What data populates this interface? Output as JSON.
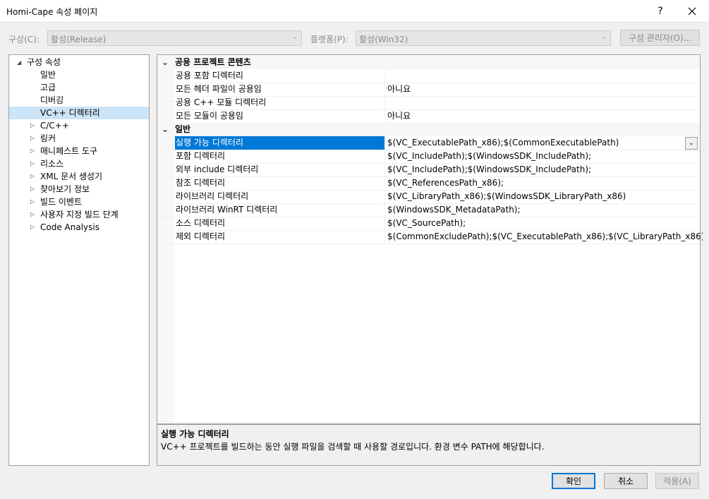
{
  "window": {
    "title": "Homi-Cape 속성 페이지",
    "help_label": "?",
    "close_label": "✕"
  },
  "toolbar": {
    "config_label": "구성(C):",
    "config_value": "활성(Release)",
    "platform_label": "플랫폼(P):",
    "platform_value": "활성(Win32)",
    "config_manager_label": "구성 관리자(O)..."
  },
  "tree": {
    "root": "구성 속성",
    "items": [
      {
        "label": "일반"
      },
      {
        "label": "고급"
      },
      {
        "label": "디버깅"
      },
      {
        "label": "VC++ 디렉터리"
      },
      {
        "label": "C/C++"
      },
      {
        "label": "링커"
      },
      {
        "label": "매니페스트 도구"
      },
      {
        "label": "리소스"
      },
      {
        "label": "XML 문서 생성기"
      },
      {
        "label": "찾아보기 정보"
      },
      {
        "label": "빌드 이벤트"
      },
      {
        "label": "사용자 지정 빌드 단계"
      },
      {
        "label": "Code Analysis"
      }
    ]
  },
  "grid": {
    "categories": [
      {
        "name": "공용 프로젝트 콘텐츠",
        "rows": [
          {
            "name": "공용 포함 디렉터리",
            "value": ""
          },
          {
            "name": "모든 헤더 파일이 공용임",
            "value": "아니요"
          },
          {
            "name": "공용 C++ 모듈 디렉터리",
            "value": ""
          },
          {
            "name": "모든 모듈이 공용임",
            "value": "아니요"
          }
        ]
      },
      {
        "name": "일반",
        "rows": [
          {
            "name": "실행 가능 디렉터리",
            "value": "$(VC_ExecutablePath_x86);$(CommonExecutablePath)"
          },
          {
            "name": "포함 디렉터리",
            "value": "$(VC_IncludePath);$(WindowsSDK_IncludePath);"
          },
          {
            "name": "외부 include 디렉터리",
            "value": "$(VC_IncludePath);$(WindowsSDK_IncludePath);"
          },
          {
            "name": "참조 디렉터리",
            "value": "$(VC_ReferencesPath_x86);"
          },
          {
            "name": "라이브러리 디렉터리",
            "value": "$(VC_LibraryPath_x86);$(WindowsSDK_LibraryPath_x86)"
          },
          {
            "name": "라이브러리 WinRT 디렉터리",
            "value": "$(WindowsSDK_MetadataPath);"
          },
          {
            "name": "소스 디렉터리",
            "value": "$(VC_SourcePath);"
          },
          {
            "name": "제외 디렉터리",
            "value": "$(CommonExcludePath);$(VC_ExecutablePath_x86);$(VC_LibraryPath_x86)"
          }
        ]
      }
    ]
  },
  "description": {
    "title": "실행 가능 디렉터리",
    "text": "VC++ 프로젝트를 빌드하는 동안 실행 파일을 검색할 때 사용할 경로입니다.  환경 변수 PATH에 해당합니다."
  },
  "buttons": {
    "ok": "확인",
    "cancel": "취소",
    "apply": "적용(A)"
  },
  "colors": {
    "selection": "#0078d7",
    "tree_selection": "#cce4f7"
  }
}
